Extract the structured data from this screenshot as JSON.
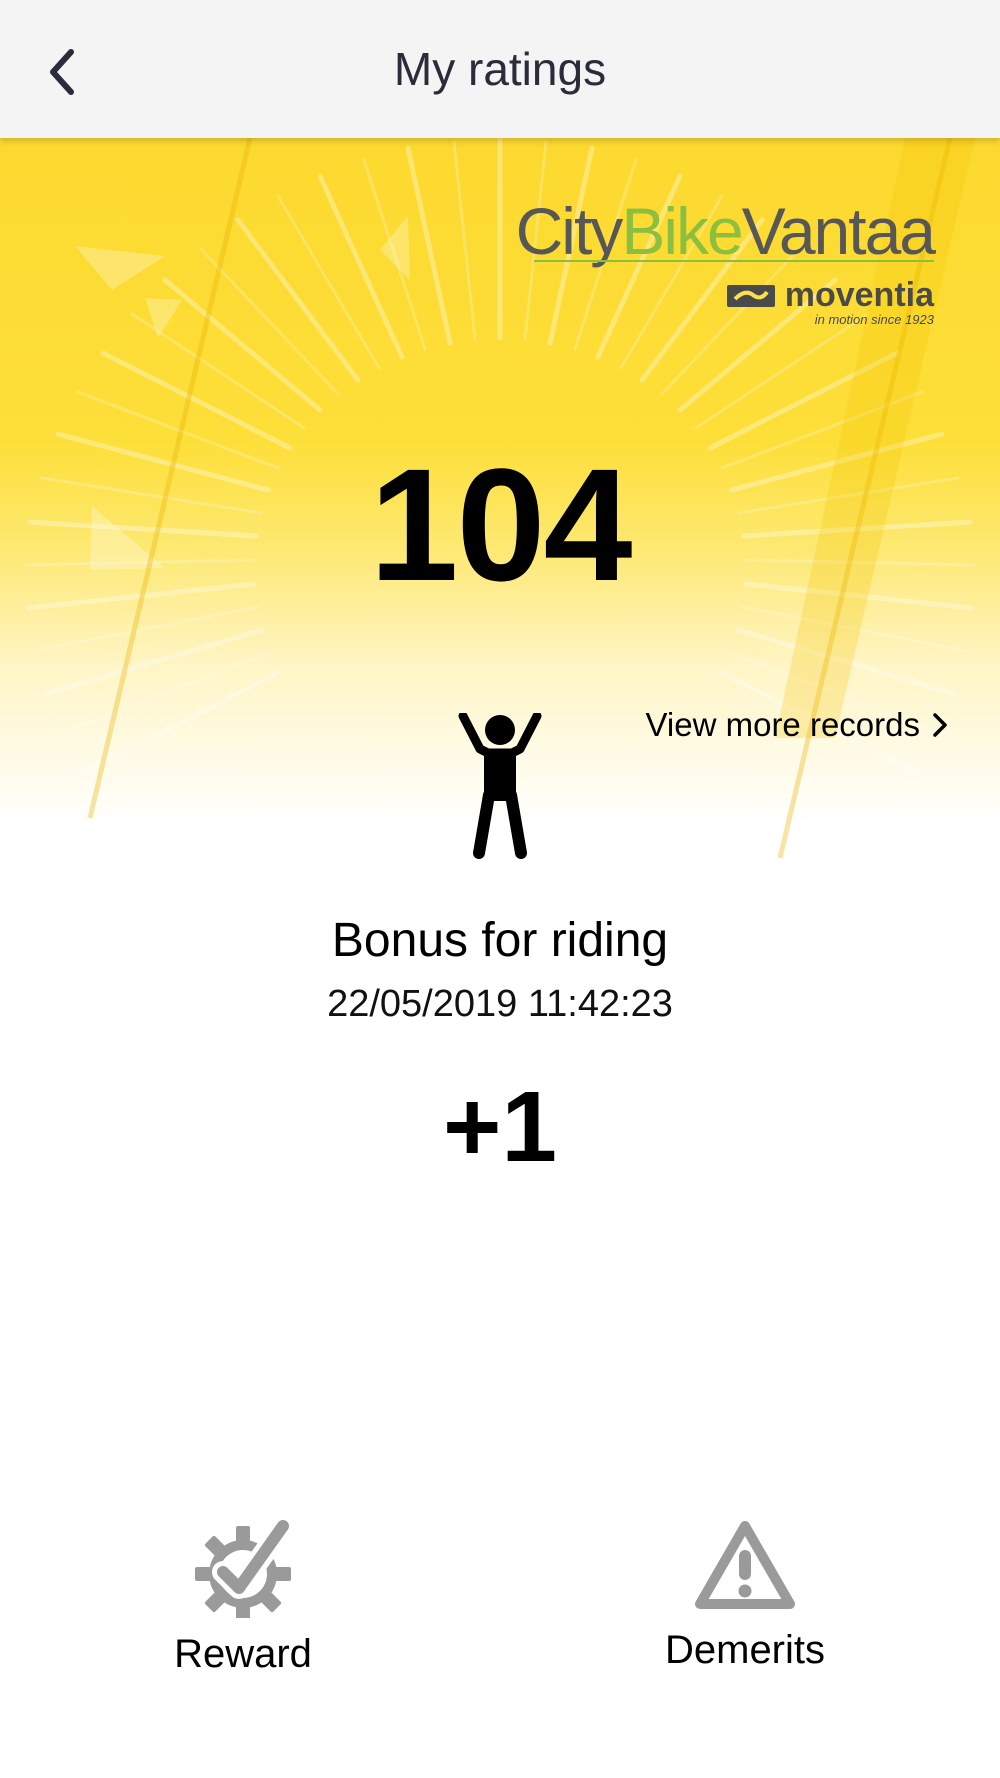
{
  "header": {
    "title": "My ratings",
    "back_icon": "chevron-left-icon"
  },
  "logo": {
    "city": "City",
    "bike": "Bike",
    "vantaa": "Vantaa",
    "brand": "moventia",
    "tagline": "in motion since 1923"
  },
  "rating": {
    "score": "104",
    "view_more_label": "View more records"
  },
  "latest_record": {
    "icon": "person-arms-raised-icon",
    "title": "Bonus for riding",
    "timestamp": "22/05/2019 11:42:23",
    "points": "+1"
  },
  "bottom_nav": {
    "reward_label": "Reward",
    "demerits_label": "Demerits"
  },
  "colors": {
    "hero_yellow": "#fcd92f",
    "logo_green": "#8cbf3f",
    "logo_gray": "#575757",
    "icon_gray": "#9a9a9a",
    "title_text": "#2b2c3a"
  }
}
